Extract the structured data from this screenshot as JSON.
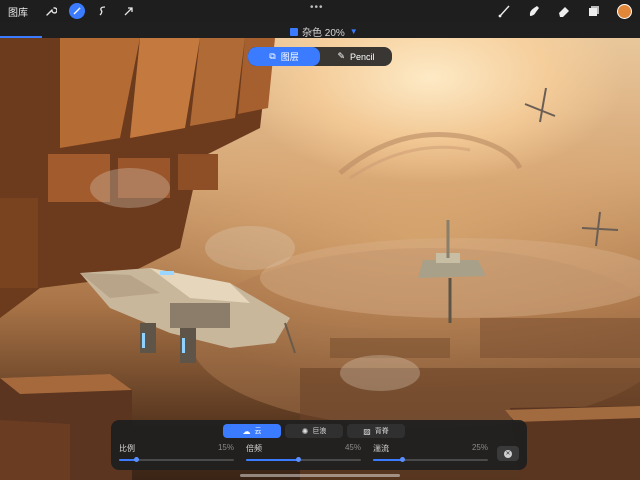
{
  "topbar": {
    "gallery_label": "图库",
    "more_label": "•••",
    "tools_left": [
      "wrench-icon",
      "magic-wand-icon",
      "selection-icon",
      "transform-icon"
    ],
    "tools_right": [
      "brush-icon",
      "smudge-icon",
      "eraser-icon",
      "layers-icon"
    ],
    "active_color": "#e0873a"
  },
  "adjustment": {
    "title": "杂色 20%",
    "accent": "#3a7bff"
  },
  "mode_toggle": {
    "layer_label": "图层",
    "pencil_label": "Pencil",
    "active": "layer"
  },
  "noise_panel": {
    "tabs": [
      {
        "label": "云",
        "icon": "cloud-icon",
        "active": true
      },
      {
        "label": "巨浪",
        "icon": "wave-icon",
        "active": false
      },
      {
        "label": "背脊",
        "icon": "ridge-icon",
        "active": false
      }
    ],
    "sliders": [
      {
        "label": "比例",
        "value_text": "15%",
        "value": 0.15
      },
      {
        "label": "倍频",
        "value_text": "45%",
        "value": 0.45
      },
      {
        "label": "湍流",
        "value_text": "25%",
        "value": 0.25
      }
    ]
  }
}
